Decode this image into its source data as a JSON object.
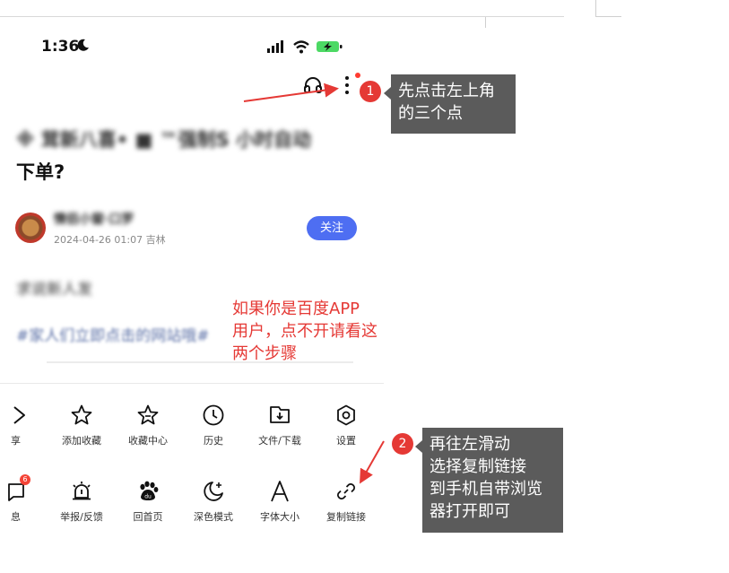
{
  "status_bar": {
    "time": "1:36"
  },
  "article": {
    "title_line1": "※ 茸新八喜•  ■ ™强制S   小时自动",
    "title_line2": "下单?",
    "author": {
      "name": "情侣小窗·口罗",
      "date": "2024-04-26 01:07",
      "location": "吉林"
    },
    "follow_label": "关注",
    "summary": "求说新人发",
    "hashtag": "#家人们立即点击的网站哦#"
  },
  "annotations": {
    "step1_number": "1",
    "step1_text": "先点击左上角\n的三个点",
    "step2_number": "2",
    "step2_text": "再往左滑动\n选择复制链接\n到手机自带浏览\n器打开即可",
    "red_note": "如果你是百度APP\n用户，点不开请看这\n两个步骤"
  },
  "menu_row1": [
    {
      "label": "享",
      "icon": "share-icon"
    },
    {
      "label": "添加收藏",
      "icon": "star-icon"
    },
    {
      "label": "收藏中心",
      "icon": "star-box-icon"
    },
    {
      "label": "历史",
      "icon": "clock-icon"
    },
    {
      "label": "文件/下载",
      "icon": "download-icon"
    },
    {
      "label": "设置",
      "icon": "settings-icon"
    }
  ],
  "menu_row2": [
    {
      "label": "息",
      "icon": "message-icon",
      "badge": "6"
    },
    {
      "label": "举报/反馈",
      "icon": "alarm-icon"
    },
    {
      "label": "回首页",
      "icon": "baidu-paw-icon"
    },
    {
      "label": "深色模式",
      "icon": "moon-star-icon"
    },
    {
      "label": "字体大小",
      "icon": "font-icon"
    },
    {
      "label": "复制链接",
      "icon": "link-icon"
    }
  ],
  "colors": {
    "accent_blue": "#4e6ef2",
    "annotation_red": "#e53935",
    "callout_gray": "#5b5b5b",
    "hashtag_blue": "#5a6fa6"
  }
}
